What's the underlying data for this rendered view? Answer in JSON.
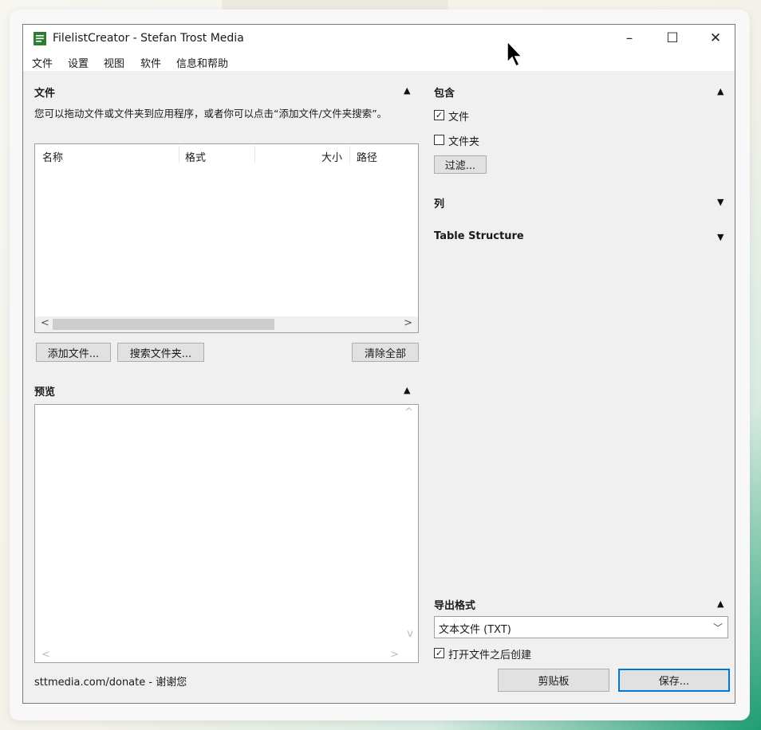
{
  "window": {
    "title": "FilelistCreator - Stefan Trost Media"
  },
  "titlebar_buttons": {
    "minimize": "–",
    "maximize": "☐",
    "close": "✕"
  },
  "menu": [
    "文件",
    "设置",
    "视图",
    "软件",
    "信息和帮助"
  ],
  "files_section": {
    "title": "文件",
    "description": "您可以拖动文件或文件夹到应用程序，或者你可以点击“添加文件/文件夹搜索”。",
    "columns": [
      "名称",
      "格式",
      "大小",
      "路径"
    ],
    "buttons": {
      "add_files": "添加文件...",
      "search_folder": "搜索文件夹...",
      "clear_all": "清除全部"
    }
  },
  "preview_section": {
    "title": "预览"
  },
  "include_section": {
    "title": "包含",
    "files_label": "文件",
    "files_checked": true,
    "folders_label": "文件夹",
    "folders_checked": false,
    "filter_button": "过滤..."
  },
  "columns_section": {
    "title": "列"
  },
  "table_structure_section": {
    "title": "Table Structure"
  },
  "export_section": {
    "title": "导出格式",
    "selected_format": "文本文件 (TXT)",
    "open_after_label": "打开文件之后创建",
    "open_after_checked": true
  },
  "footer": {
    "donate_text": "sttmedia.com/donate - 谢谢您",
    "clipboard_button": "剪贴板",
    "save_button": "保存..."
  },
  "icons": {
    "collapse": "▲",
    "expand": "▼",
    "scroll_left": "<",
    "scroll_right": ">",
    "scroll_up": "^",
    "scroll_down": "v",
    "dropdown": "﹀",
    "check": "✓"
  },
  "colors": {
    "accent_border": "#0078d7",
    "app_icon": "#2e7d32"
  }
}
